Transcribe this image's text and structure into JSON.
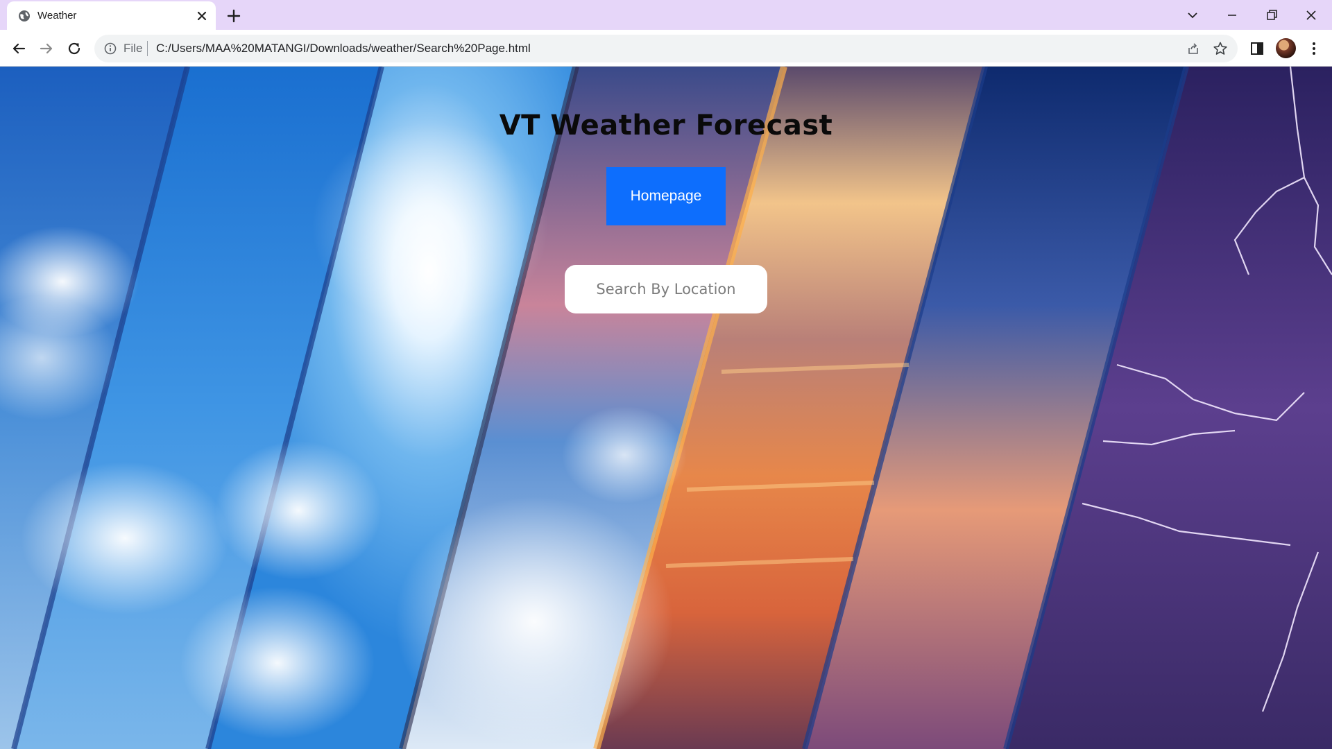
{
  "browser": {
    "tab_title": "Weather",
    "address_scheme": "File",
    "url": "C:/Users/MAA%20MATANGI/Downloads/weather/Search%20Page.html"
  },
  "page": {
    "title": "VT Weather Forecast",
    "home_button": "Homepage",
    "search_placeholder": "Search By Location"
  },
  "colors": {
    "tabbar_bg": "#e6d6f9",
    "primary_button": "#0d6efd",
    "title_text": "#0a0a0a"
  },
  "icons": {
    "tab_favicon": "globe-icon",
    "tab_close": "close-icon",
    "new_tab": "plus-icon",
    "back": "arrow-left-icon",
    "forward": "arrow-right-icon",
    "reload": "reload-icon",
    "site_info": "info-icon",
    "share": "share-icon",
    "bookmark": "star-icon",
    "side_panel": "side-panel-icon",
    "menu": "kebab-menu-icon"
  },
  "background": {
    "description_panels": [
      "clouds",
      "sun",
      "clouds-sky",
      "sunset",
      "evening-sky",
      "lightning-storm"
    ]
  }
}
